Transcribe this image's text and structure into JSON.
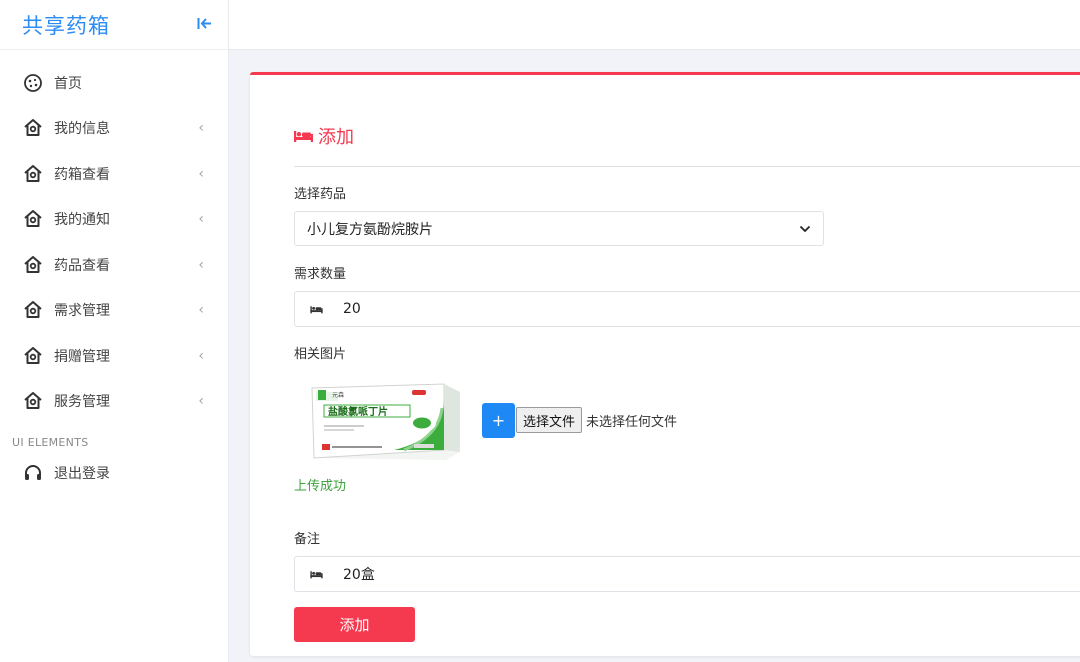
{
  "app": {
    "title": "共享药箱"
  },
  "sidebar": {
    "items": [
      {
        "label": "首页",
        "icon": "cookie-icon",
        "has_arrow": false
      },
      {
        "label": "我的信息",
        "icon": "home-icon",
        "has_arrow": true
      },
      {
        "label": "药箱查看",
        "icon": "home-icon",
        "has_arrow": true
      },
      {
        "label": "我的通知",
        "icon": "home-icon",
        "has_arrow": true
      },
      {
        "label": "药品查看",
        "icon": "home-icon",
        "has_arrow": true
      },
      {
        "label": "需求管理",
        "icon": "home-icon",
        "has_arrow": true
      },
      {
        "label": "捐赠管理",
        "icon": "home-icon",
        "has_arrow": true
      },
      {
        "label": "服务管理",
        "icon": "home-icon",
        "has_arrow": true
      }
    ],
    "section_title": "UI ELEMENTS",
    "logout_label": "退出登录",
    "arrow_glyph": "‹"
  },
  "card": {
    "title": "添加",
    "accent_color": "#f5394f"
  },
  "form": {
    "medicine_label": "选择药品",
    "medicine_value": "小儿复方氨酚烷胺片",
    "quantity_label": "需求数量",
    "quantity_value": "20",
    "image_label": "相关图片",
    "file_plus": "+",
    "file_button": "选择文件",
    "file_status": "未选择任何文件",
    "upload_status": "上传成功",
    "note_label": "备注",
    "note_value": "20盒",
    "submit_label": "添加"
  },
  "thumbnail": {
    "box_text": "盐酸氯哌丁片"
  },
  "colors": {
    "brand": "#2b8cf3",
    "accent": "#f5394f",
    "success": "#3da33d",
    "file_plus": "#1e88f5"
  }
}
